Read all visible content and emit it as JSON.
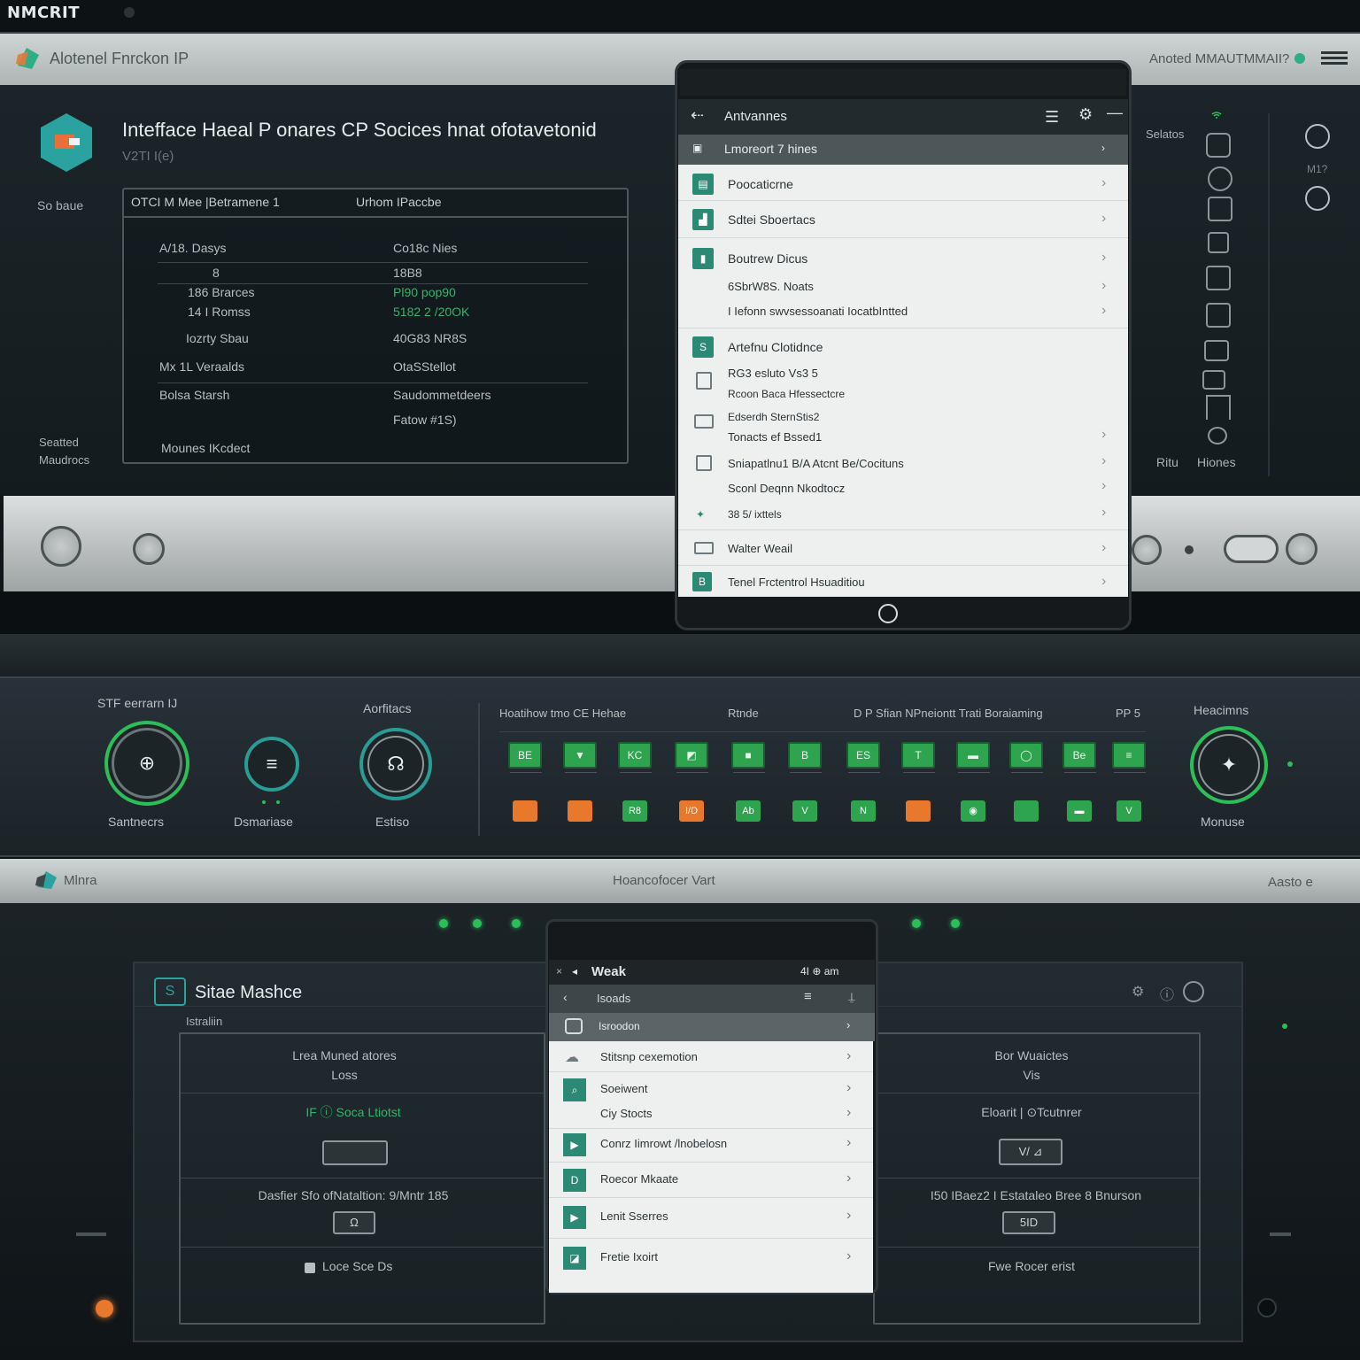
{
  "brand": "NMCRIT",
  "top_window": {
    "title": "Alotenel Fnrckon IP",
    "right_text": "Anoted MMAUTMMAII?",
    "screen_title": "Intefface Haeal  P onares CP Socices hnat ofotavetonid",
    "screen_sub": "V2TI I(e)",
    "side_label": "So baue",
    "side_label_bottom": "Seatted Maudrocs",
    "panel_header_left": "OTCI M Mee |Betramene 1",
    "panel_header_right": "Urhom IPaccbe",
    "rows": [
      {
        "left": "A/18. Dasys",
        "right": "Co18c Nies"
      },
      {
        "left": "8",
        "right": "18B8"
      },
      {
        "left": "186 Brarces",
        "right": "Pl90 pop90",
        "right_green": true
      },
      {
        "left": "14 I Romss",
        "right": "5182 2 /20OK",
        "right_green": true
      },
      {
        "left": "Iozrty Sbau",
        "right": "40G83 NR8S"
      },
      {
        "left": "Mx 1L Veraalds",
        "right": "OtaSStellot"
      },
      {
        "left": "Bolsa Starsh",
        "right": "Saudommetdeers"
      },
      {
        "left": "",
        "right": "Fatow  #1S)"
      },
      {
        "left": "Mounes IKcdect",
        "right": ""
      }
    ],
    "right_strip_label": "Selatos",
    "right_small": "M1?",
    "right_bottom_left": "Ritu",
    "right_bottom_right": "Hiones"
  },
  "tablet": {
    "app_title": "Antvannes",
    "selected": "Lmoreort 7 hines",
    "items": [
      {
        "label": "Poocaticrne",
        "icon": "device-icon"
      },
      {
        "label": "Sdtei Sboertacs",
        "icon": "chart-icon"
      },
      {
        "label": "Boutrew Dicus",
        "icon": "doc-icon"
      },
      {
        "label": "6SbrW8S. Noats",
        "icon": ""
      },
      {
        "label": "I Iefonn swvsessoanati IocatbIntted",
        "icon": ""
      },
      {
        "label": "Artefnu Clotidnce",
        "icon": "s-icon"
      },
      {
        "label": "RG3 esluto Vs3 5",
        "icon": ""
      },
      {
        "label": "Rcoon Baca Hfessectcre",
        "icon": ""
      },
      {
        "label": "Edserdh SternStis2",
        "icon": ""
      },
      {
        "label": "Tonacts ef Bssed1",
        "icon": ""
      },
      {
        "label": "Sniapatlnu1 B/A Atcnt Be/Cocituns",
        "icon": ""
      },
      {
        "label": "Sconl Deqnn Nkodtocz",
        "icon": ""
      },
      {
        "label": "38 5/ ixttels",
        "icon": ""
      },
      {
        "label": "Walter Weail",
        "icon": ""
      },
      {
        "label": "Tenel Frctentrol Hsuaditiou",
        "icon": "b-icon"
      }
    ]
  },
  "rack": {
    "dial1_top": "STF eerrarn IJ",
    "dial1_bottom": "Santnecrs",
    "dial2_bottom": "Dsmariase",
    "dial3_top": "Aorfitacs",
    "dial3_bottom": "Estiso",
    "grid_title_left": "Hoatihow tmo CE Hehae",
    "grid_title_mid": "Rtnde",
    "grid_title_right": "D P Sfian NPneiontt Trati Boraiaming",
    "grid_title_num": "PP 5",
    "right_dial_top": "Heacimns",
    "right_dial_bottom": "Monuse",
    "green_row": [
      "BE",
      "▼",
      "KC",
      "◩",
      "■",
      "B",
      "ES",
      "T",
      "▬",
      "◯",
      "Be",
      "≡"
    ],
    "bottom_row": [
      "",
      "",
      "R8",
      "I/D",
      "Ab",
      "V",
      "N",
      "",
      "◉",
      "",
      "▬",
      "V"
    ],
    "colors": {
      "green": "#2ea44f",
      "orange": "#e7782c"
    }
  },
  "bottom_window": {
    "title_left": "Mlnra",
    "title_mid": "Hoancofocer Vart",
    "title_right": "Aasto e",
    "screen_title": "Sitae Mashce",
    "screen_sub": "Istraliin",
    "left_panel": [
      {
        "title": "Lrea Muned atores",
        "sub": "Loss"
      },
      {
        "title": "IF ⓘ Soca Ltiotst",
        "sub": "",
        "green": true
      },
      {
        "title": "Dasfier Sfo ofNataltion: 9/Mntr 185",
        "sub": ""
      },
      {
        "title": "Loce Sce Ds",
        "sub": ""
      }
    ],
    "right_panel": [
      {
        "title": "Bor Wuaictes",
        "sub": "Vis"
      },
      {
        "title": "Eloarit | ⊙Tcutnrer",
        "sub": ""
      },
      {
        "title": "I50 IBaez2 I Estataleo Bree 8  Bnurson",
        "sub": ""
      },
      {
        "title": "Fwe Rocer erist",
        "sub": ""
      }
    ],
    "left_box_1": "",
    "left_box_2": "Ω",
    "right_box_1": "V/ ⊿",
    "right_box_2": "5ID"
  },
  "phone": {
    "title": "Weak",
    "status_right": "4I  ⊕  am",
    "search": "Isoads",
    "selected": "Isroodon",
    "items": [
      {
        "label": "Stitsnp cexemotion"
      },
      {
        "label": "Soeiwent"
      },
      {
        "label": "Ciy Stocts"
      },
      {
        "label": "Conrz Iimrowt /lnobelosn"
      },
      {
        "label": "Roecor Mkaate"
      },
      {
        "label": "Lenit Sserres"
      },
      {
        "label": "Fretie Ixoirt"
      }
    ]
  }
}
